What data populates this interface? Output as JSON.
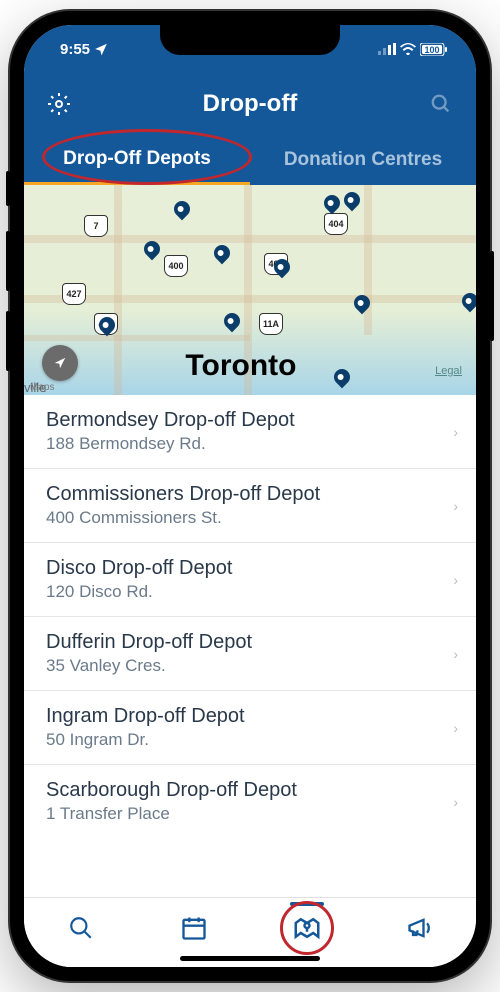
{
  "statusBar": {
    "time": "9:55",
    "battery": "100"
  },
  "header": {
    "title": "Drop-off"
  },
  "tabs": {
    "tab1": "Drop-Off Depots",
    "tab2": "Donation Centres"
  },
  "map": {
    "cityLabel": "Toronto",
    "legal": "Legal",
    "attribution": "Maps",
    "corner": "ville",
    "shields": [
      "7",
      "427",
      "404",
      "401",
      "400",
      "409",
      "11A"
    ]
  },
  "depots": [
    {
      "name": "Bermondsey Drop-off Depot",
      "address": "188 Bermondsey Rd."
    },
    {
      "name": "Commissioners Drop-off Depot",
      "address": "400 Commissioners St."
    },
    {
      "name": "Disco Drop-off Depot",
      "address": "120 Disco Rd."
    },
    {
      "name": "Dufferin Drop-off Depot",
      "address": "35 Vanley Cres."
    },
    {
      "name": "Ingram Drop-off Depot",
      "address": "50 Ingram Dr."
    },
    {
      "name": "Scarborough Drop-off Depot",
      "address": "1 Transfer Place"
    }
  ]
}
